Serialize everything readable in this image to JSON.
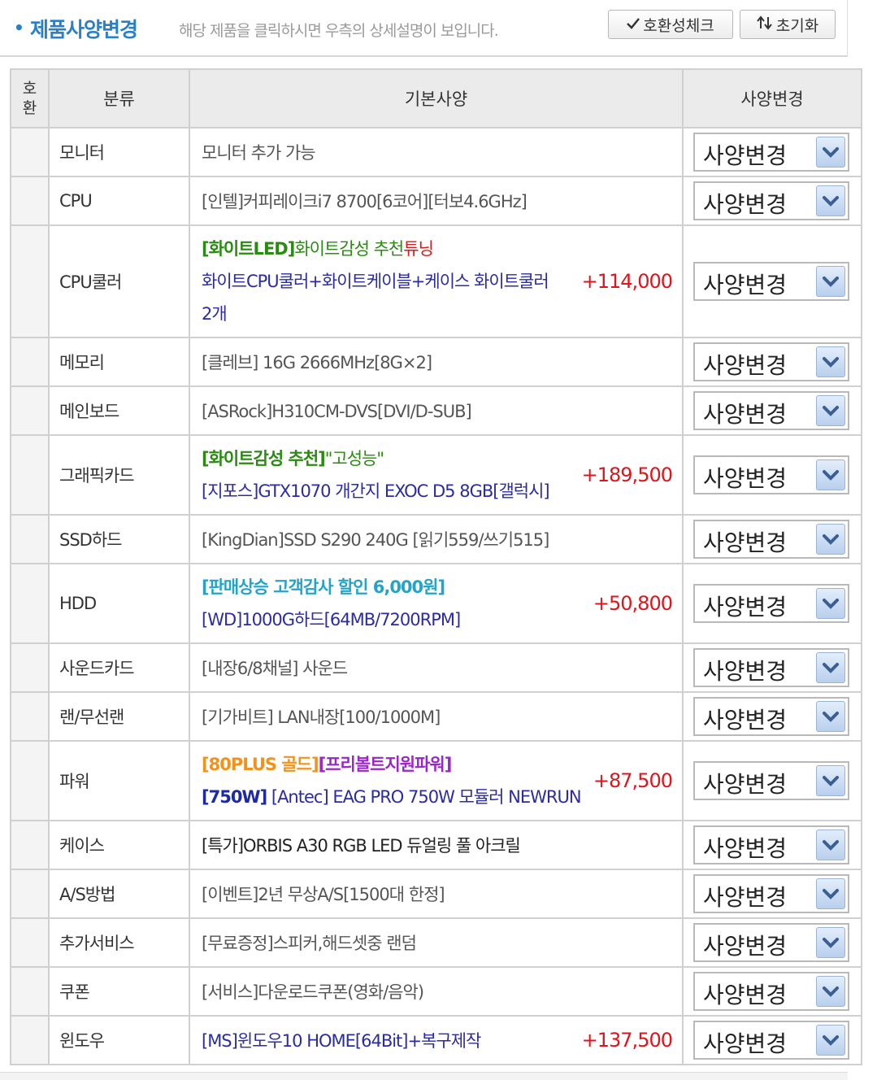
{
  "header": {
    "title": "제품사양변경",
    "description": "해당 제품을 클릭하시면 우측의 상세설명이 보입니다.",
    "compat_button": "호환성체크",
    "reset_button": "초기화"
  },
  "table": {
    "col_compat": "호환",
    "col_category": "분류",
    "col_spec": "기본사양",
    "col_change": "사양변경"
  },
  "select_label": "사양변경",
  "rows": [
    {
      "category": "모니터",
      "lines": [
        [
          {
            "t": "모니터 추가 가능",
            "c": "gray"
          }
        ]
      ],
      "price": ""
    },
    {
      "category": "CPU",
      "lines": [
        [
          {
            "t": "[인텔]커피레이크i7 8700[6코어][터보4.6GHz]",
            "c": "gray"
          }
        ]
      ],
      "price": ""
    },
    {
      "category": "CPU쿨러",
      "lines": [
        [
          {
            "t": "[화이트LED]",
            "c": "green"
          },
          {
            "t": "화이트감성 추천",
            "c": "green-r"
          },
          {
            "t": "튜닝",
            "c": "red"
          }
        ],
        [
          {
            "t": "화이트CPU쿨러+화이트케이블+케이스 화이트쿨러",
            "c": "navy"
          }
        ],
        [
          {
            "t": "2개",
            "c": "navy"
          }
        ]
      ],
      "price": "+114,000"
    },
    {
      "category": "메모리",
      "lines": [
        [
          {
            "t": "[클레브] 16G 2666MHz[8G×2]",
            "c": "gray"
          }
        ]
      ],
      "price": ""
    },
    {
      "category": "메인보드",
      "lines": [
        [
          {
            "t": "[ASRock]H310CM-DVS[DVI/D-SUB]",
            "c": "gray"
          }
        ]
      ],
      "price": ""
    },
    {
      "category": "그래픽카드",
      "lines": [
        [
          {
            "t": "[화이트감성 추천]",
            "c": "green"
          },
          {
            "t": "\"고성능\"",
            "c": "green-r"
          }
        ],
        [
          {
            "t": "[지포스]GTX1070 개간지 EXOC D5 8GB[갤럭시]",
            "c": "navy"
          }
        ]
      ],
      "price": "+189,500"
    },
    {
      "category": "SSD하드",
      "lines": [
        [
          {
            "t": "[KingDian]SSD S290 240G [읽기559/쓰기515]",
            "c": "gray"
          }
        ]
      ],
      "price": ""
    },
    {
      "category": "HDD",
      "lines": [
        [
          {
            "t": "[판매상승 고객감사 할인 6,000원]",
            "c": "teal"
          }
        ],
        [
          {
            "t": "[WD]1000G하드[64MB/7200RPM]",
            "c": "navy"
          }
        ]
      ],
      "price": "+50,800"
    },
    {
      "category": "사운드카드",
      "lines": [
        [
          {
            "t": "[내장6/8채널] 사운드",
            "c": "gray"
          }
        ]
      ],
      "price": ""
    },
    {
      "category": "랜/무선랜",
      "lines": [
        [
          {
            "t": "[기가비트] LAN내장[100/1000M]",
            "c": "gray"
          }
        ]
      ],
      "price": ""
    },
    {
      "category": "파워",
      "lines": [
        [
          {
            "t": "[80PLUS 골드]",
            "c": "orange"
          },
          {
            "t": "[프리볼트지원파워]",
            "c": "magenta"
          }
        ],
        [
          {
            "t": "[750W]",
            "c": "navybold"
          },
          {
            "t": " [Antec] EAG PRO 750W 모듈러 NEWRUN",
            "c": "navy"
          }
        ]
      ],
      "price": "+87,500"
    },
    {
      "category": "케이스",
      "lines": [
        [
          {
            "t": "[특가]ORBIS A30 RGB LED 듀얼링 풀 아크릴",
            "c": "dark"
          }
        ]
      ],
      "price": ""
    },
    {
      "category": "A/S방법",
      "lines": [
        [
          {
            "t": "[이벤트]2년 무상A/S[1500대 한정]",
            "c": "gray"
          }
        ]
      ],
      "price": ""
    },
    {
      "category": "추가서비스",
      "lines": [
        [
          {
            "t": "[무료증정]스피커,해드셋중 랜덤",
            "c": "gray"
          }
        ]
      ],
      "price": ""
    },
    {
      "category": "쿠폰",
      "lines": [
        [
          {
            "t": "[서비스]다운로드쿠폰(영화/음악)",
            "c": "gray"
          }
        ]
      ],
      "price": ""
    },
    {
      "category": "윈도우",
      "lines": [
        [
          {
            "t": "[MS]윈도우10 HOME[64Bit]+복구제작",
            "c": "navy"
          }
        ]
      ],
      "price": "+137,500"
    }
  ],
  "icons": {
    "compat": "check-icon",
    "reset": "sort-arrows-icon",
    "select": "chevron-down-icon"
  },
  "colors": {
    "accent": "#2a80c7",
    "price": "#e0141b",
    "header_bg": "#ebebeb"
  }
}
